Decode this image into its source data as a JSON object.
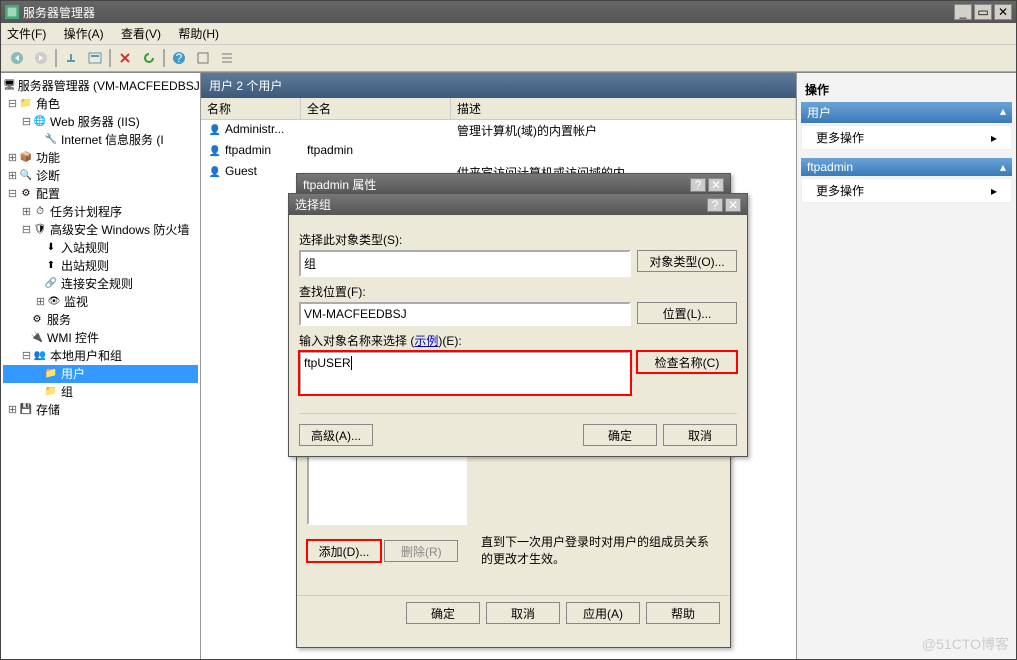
{
  "window": {
    "title": "服务器管理器"
  },
  "win_controls": {
    "min": "_",
    "restore": "▭",
    "close": "✕"
  },
  "menu": {
    "file": "文件(F)",
    "action": "操作(A)",
    "view": "查看(V)",
    "help": "帮助(H)"
  },
  "tree": {
    "root": "服务器管理器 (VM-MACFEEDBSJ)",
    "roles": "角色",
    "web_iis": "Web 服务器 (IIS)",
    "iis_info": "Internet 信息服务 (I",
    "features": "功能",
    "diagnostics": "诊断",
    "config": "配置",
    "task_sched": "任务计划程序",
    "firewall": "高级安全 Windows 防火墙",
    "inbound": "入站规则",
    "outbound": "出站规则",
    "conn_sec": "连接安全规则",
    "monitor": "监视",
    "services": "服务",
    "wmi": "WMI 控件",
    "lug": "本地用户和组",
    "users": "用户",
    "groups": "组",
    "storage": "存储"
  },
  "center": {
    "header": "用户    2 个用户",
    "cols": {
      "name": "名称",
      "full": "全名",
      "desc": "描述"
    },
    "rows": [
      {
        "name": "Administr...",
        "full": "",
        "desc": "管理计算机(域)的内置帐户"
      },
      {
        "name": "ftpadmin",
        "full": "ftpadmin",
        "desc": ""
      },
      {
        "name": "Guest",
        "full": "",
        "desc": "供来宾访问计算机或访问域的内..."
      }
    ]
  },
  "actions": {
    "title": "操作",
    "group1": "用户",
    "more1": "更多操作",
    "group2": "ftpadmin",
    "more2": "更多操作"
  },
  "prop_dialog": {
    "title": "ftpadmin 属性",
    "add": "添加(D)...",
    "remove": "删除(R)",
    "note": "直到下一次用户登录时对用户的组成员关系的更改才生效。",
    "ok": "确定",
    "cancel": "取消",
    "apply": "应用(A)",
    "help": "帮助"
  },
  "select_dialog": {
    "title": "选择组",
    "obj_type_label": "选择此对象类型(S):",
    "obj_type_value": "组",
    "obj_type_btn": "对象类型(O)...",
    "loc_label": "查找位置(F):",
    "loc_value": "VM-MACFEEDBSJ",
    "loc_btn": "位置(L)...",
    "name_label_pre": "输入对象名称来选择 (",
    "name_label_link": "示例",
    "name_label_post": ")(E):",
    "name_value": "ftpUSER",
    "check_btn": "检查名称(C)",
    "advanced": "高级(A)...",
    "ok": "确定",
    "cancel": "取消"
  },
  "watermark": "@51CTO博客"
}
